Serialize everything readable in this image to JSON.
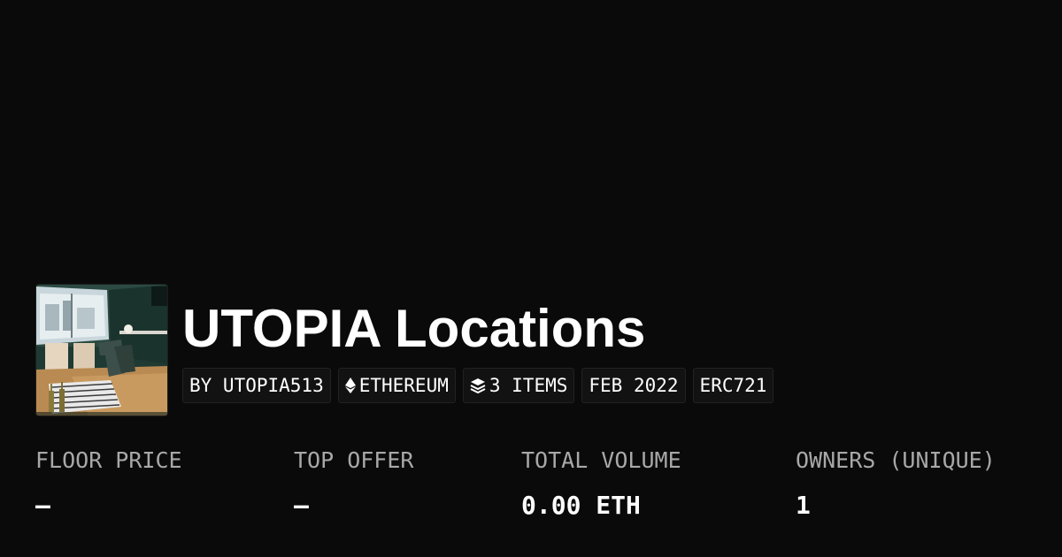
{
  "collection": {
    "name": "UTOPIA Locations",
    "image_alt_icon": "collection-thumbnail"
  },
  "tags": [
    {
      "label": "BY UTOPIA513",
      "icon": ""
    },
    {
      "label": "ETHEREUM",
      "icon": "ethereum-icon"
    },
    {
      "label": "3 ITEMS",
      "icon": "layers-icon"
    },
    {
      "label": "FEB 2022",
      "icon": ""
    },
    {
      "label": "ERC721",
      "icon": ""
    }
  ],
  "stats": [
    {
      "label": "FLOOR PRICE",
      "value": "—"
    },
    {
      "label": "TOP OFFER",
      "value": "—"
    },
    {
      "label": "TOTAL VOLUME",
      "value": "0.00 ETH"
    },
    {
      "label": "OWNERS (UNIQUE)",
      "value": "1"
    }
  ],
  "colors": {
    "background": "#0a0a0a",
    "text": "#ffffff",
    "muted": "#a8a8a8",
    "tag_bg": "#121212",
    "tag_border": "#222222"
  }
}
